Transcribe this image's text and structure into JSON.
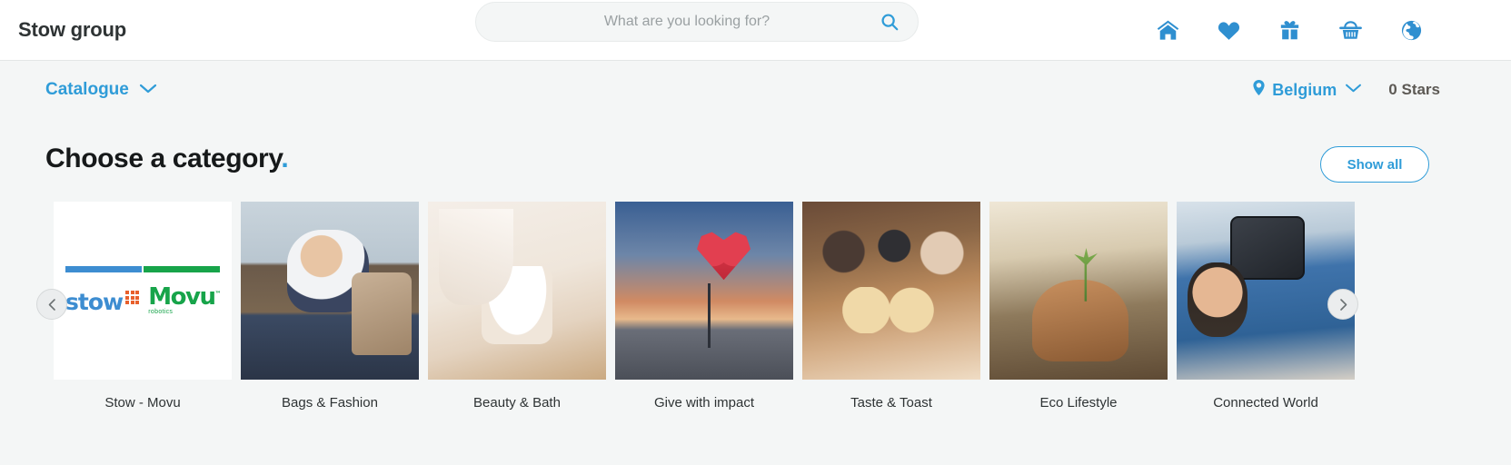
{
  "header": {
    "brand": "Stow group",
    "search": {
      "placeholder": "What are you looking for?",
      "value": "",
      "icon": "search-icon"
    },
    "icons": [
      {
        "name": "home-icon",
        "label": "Home"
      },
      {
        "name": "heart-icon",
        "label": "Favourites"
      },
      {
        "name": "gift-icon",
        "label": "Gifts"
      },
      {
        "name": "basket-icon",
        "label": "Basket"
      },
      {
        "name": "globe-icon",
        "label": "Language"
      }
    ],
    "accent_color": "#2f9cd8"
  },
  "subbar": {
    "catalogue_label": "Catalogue",
    "catalogue_chevron": "chevron-down-icon",
    "country_pin": "location-pin-icon",
    "country_label": "Belgium",
    "country_chevron": "chevron-down-icon",
    "stars_label": "0 Stars"
  },
  "main": {
    "section_title": "Choose a category",
    "section_title_dot": ".",
    "show_all_label": "Show all",
    "prev_label": "‹",
    "next_label": "›",
    "categories": [
      {
        "label": "Stow - Movu",
        "thumb": "logo",
        "logo": {
          "stow": "stow",
          "movu": "Movu",
          "movu_tm": "™",
          "movu_sub": "robotics"
        }
      },
      {
        "label": "Bags & Fashion",
        "thumb": "bags"
      },
      {
        "label": "Beauty & Bath",
        "thumb": "beauty"
      },
      {
        "label": "Give with impact",
        "thumb": "give"
      },
      {
        "label": "Taste & Toast",
        "thumb": "taste"
      },
      {
        "label": "Eco Lifestyle",
        "thumb": "eco"
      },
      {
        "label": "Connected World",
        "thumb": "connected"
      }
    ]
  }
}
